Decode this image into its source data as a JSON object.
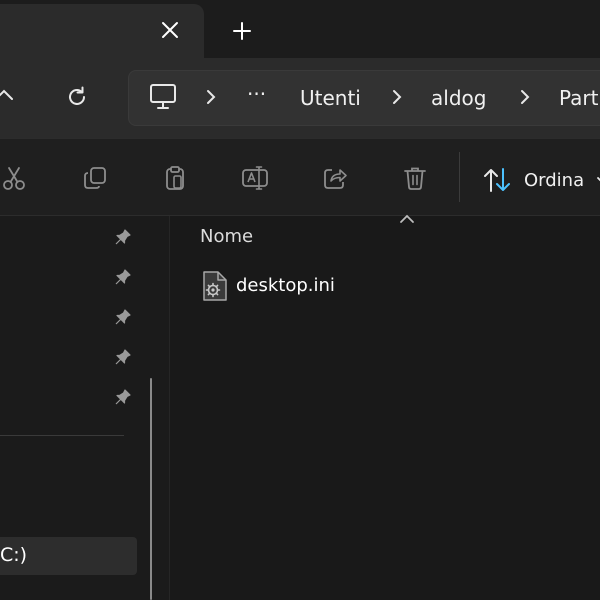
{
  "address": {
    "overflow": "···",
    "crumbs": [
      "Utenti",
      "aldog",
      "Part"
    ]
  },
  "toolbar": {
    "sort_label": "Ordina"
  },
  "list": {
    "column_header": "Nome",
    "files": [
      {
        "name": "desktop.ini",
        "icon": "settings-file-icon"
      }
    ]
  },
  "nav": {
    "pinned_count": 5,
    "drive_label": "C:)"
  },
  "colors": {
    "background": "#191919",
    "toolbar_background": "#2b2b2b",
    "sort_accent": "#4cc2ff"
  }
}
